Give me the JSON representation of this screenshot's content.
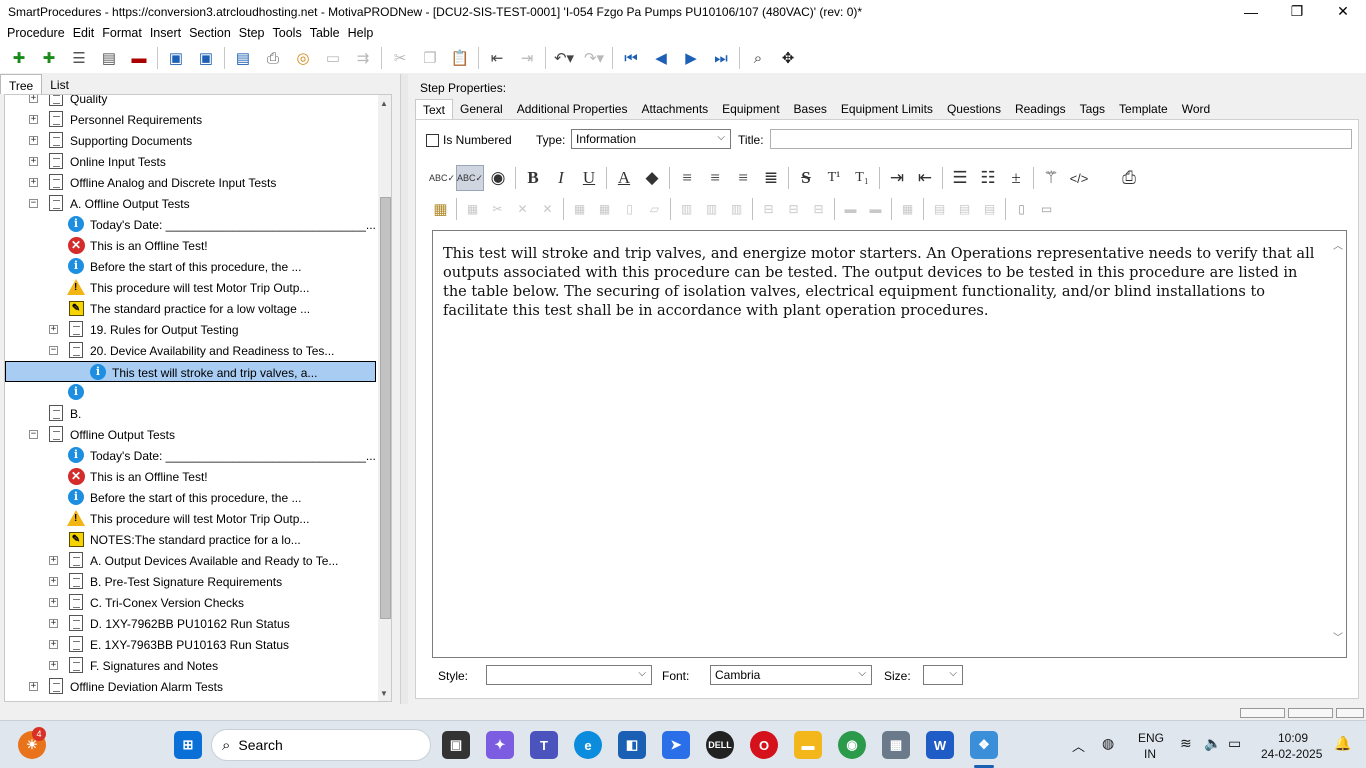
{
  "window": {
    "title": "SmartProcedures - https://conversion3.atrcloudhosting.net - MotivaPRODNew - [DCU2-SIS-TEST-0001] 'I-054 Fzgo Pa Pumps PU10106/107 (480VAC)' (rev: 0)*",
    "minimize": "—",
    "maximize": "❐",
    "close": "✕"
  },
  "menu": [
    "Procedure",
    "Edit",
    "Format",
    "Insert",
    "Section",
    "Step",
    "Tools",
    "Table",
    "Help"
  ],
  "left_tabs": [
    "Tree",
    "List"
  ],
  "tree": [
    {
      "label": "Quality",
      "icon": "doc",
      "exp": "+"
    },
    {
      "label": "Personnel Requirements",
      "icon": "doc",
      "exp": "+"
    },
    {
      "label": "Supporting Documents",
      "icon": "doc",
      "exp": "+"
    },
    {
      "label": "Online Input Tests",
      "icon": "doc",
      "exp": "+"
    },
    {
      "label": "Offline Analog and Discrete Input Tests",
      "icon": "doc",
      "exp": "+"
    },
    {
      "label": "A. Offline Output Tests",
      "icon": "doc",
      "exp": "−"
    },
    {
      "label": "Today's Date: ______________________________...",
      "icon": "info",
      "exp": ""
    },
    {
      "label": "This is an Offline Test!",
      "icon": "err",
      "exp": ""
    },
    {
      "label": "Before the start of this procedure, the ...",
      "icon": "info",
      "exp": ""
    },
    {
      "label": "This procedure will test Motor Trip Outp...",
      "icon": "warn",
      "exp": ""
    },
    {
      "label": "The standard practice for a low voltage ...",
      "icon": "note",
      "exp": ""
    },
    {
      "label": "19. Rules for Output Testing",
      "icon": "doc",
      "exp": "+"
    },
    {
      "label": "20. Device Availability and Readiness to Tes...",
      "icon": "doc",
      "exp": "−"
    },
    {
      "label": "This test will stroke and trip valves, a...",
      "icon": "info",
      "exp": ""
    },
    {
      "label": "",
      "icon": "info",
      "exp": ""
    },
    {
      "label": "B.",
      "icon": "doc",
      "exp": ""
    },
    {
      "label": "Offline Output Tests",
      "icon": "doc",
      "exp": "−"
    },
    {
      "label": "Today's Date: ______________________________...",
      "icon": "info",
      "exp": ""
    },
    {
      "label": "This is an Offline Test!",
      "icon": "err",
      "exp": ""
    },
    {
      "label": "Before the start of this procedure, the ...",
      "icon": "info",
      "exp": ""
    },
    {
      "label": "This procedure will test Motor Trip Outp...",
      "icon": "warn",
      "exp": ""
    },
    {
      "label": "NOTES:The standard practice for a lo...",
      "icon": "note",
      "exp": ""
    },
    {
      "label": "A. Output Devices Available and Ready to Te...",
      "icon": "doc",
      "exp": "+"
    },
    {
      "label": "B. Pre-Test Signature Requirements",
      "icon": "doc",
      "exp": "+"
    },
    {
      "label": "C. Tri-Conex Version Checks",
      "icon": "doc",
      "exp": "+"
    },
    {
      "label": "D. 1XY-7962BB PU10162 Run Status",
      "icon": "doc",
      "exp": "+"
    },
    {
      "label": "E. 1XY-7963BB PU10163 Run Status",
      "icon": "doc",
      "exp": "+"
    },
    {
      "label": "F. Signatures and Notes",
      "icon": "doc",
      "exp": "+"
    },
    {
      "label": "Offline Deviation Alarm Tests",
      "icon": "doc",
      "exp": "+"
    }
  ],
  "step": {
    "header": "Step Properties:",
    "tabs": [
      "Text",
      "General",
      "Additional Properties",
      "Attachments",
      "Equipment",
      "Bases",
      "Equipment Limits",
      "Questions",
      "Readings",
      "Tags",
      "Template",
      "Word"
    ],
    "is_numbered_label": "Is Numbered",
    "type_label": "Type:",
    "type_value": "Information",
    "title_label": "Title:",
    "title_value": "",
    "body": "This test will stroke and trip valves, and energize motor starters. An Operations representative needs to verify that all outputs associated with this procedure can be tested. The output devices to be tested in this procedure are listed in the table below. The securing of isolation valves, electrical equipment functionality, and/or blind installations to facilitate this test shall be in accordance with plant operation procedures.",
    "style_label": "Style:",
    "style_value": "",
    "font_label": "Font:",
    "font_value": "Cambria",
    "size_label": "Size:",
    "size_value": ""
  },
  "format_buttons": {
    "bold": "B",
    "italic": "I",
    "underline": "U",
    "font_color": "A",
    "strike": "S",
    "superscript": "T¹",
    "subscript": "T₁",
    "html": "</>",
    "spell": "ABC✓"
  },
  "taskbar": {
    "search_placeholder": "Search",
    "notification_badge": "4",
    "language": "ENG",
    "region": "IN",
    "time": "10:09",
    "date": "24-02-2025"
  }
}
